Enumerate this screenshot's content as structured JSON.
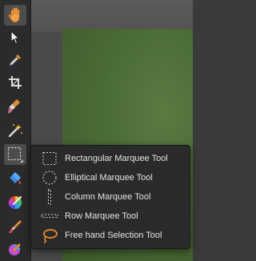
{
  "toolbar": {
    "tools": [
      {
        "name": "view-tool",
        "icon": "hand-icon"
      },
      {
        "name": "move-tool",
        "icon": "arrow-cursor-icon"
      },
      {
        "name": "color-picker-tool",
        "icon": "eyedropper-icon"
      },
      {
        "name": "crop-tool",
        "icon": "crop-icon"
      },
      {
        "name": "selection-brush-tool",
        "icon": "selection-brush-icon"
      },
      {
        "name": "flood-select-tool",
        "icon": "magic-wand-icon"
      },
      {
        "name": "marquee-tool",
        "icon": "marquee-rectangle-icon"
      },
      {
        "name": "flood-fill-tool",
        "icon": "paint-bucket-icon"
      },
      {
        "name": "color-brush-tool",
        "icon": "color-wheel-icon"
      },
      {
        "name": "paint-brush-tool",
        "icon": "paintbrush-icon"
      },
      {
        "name": "gradient-tool",
        "icon": "gradient-brush-icon"
      }
    ]
  },
  "flyout": {
    "items": [
      {
        "label": "Rectangular Marquee Tool",
        "icon": "rectangle-marquee-icon"
      },
      {
        "label": "Elliptical Marquee Tool",
        "icon": "ellipse-marquee-icon"
      },
      {
        "label": "Column Marquee Tool",
        "icon": "column-marquee-icon"
      },
      {
        "label": "Row Marquee Tool",
        "icon": "row-marquee-icon"
      },
      {
        "label": "Free hand Selection Tool",
        "icon": "lasso-icon"
      }
    ]
  },
  "colors": {
    "accent": "#e8892b",
    "menu_text": "#e4e4e4",
    "panel_bg": "#2a2a2a",
    "canvas_green": "#4a6a35"
  }
}
